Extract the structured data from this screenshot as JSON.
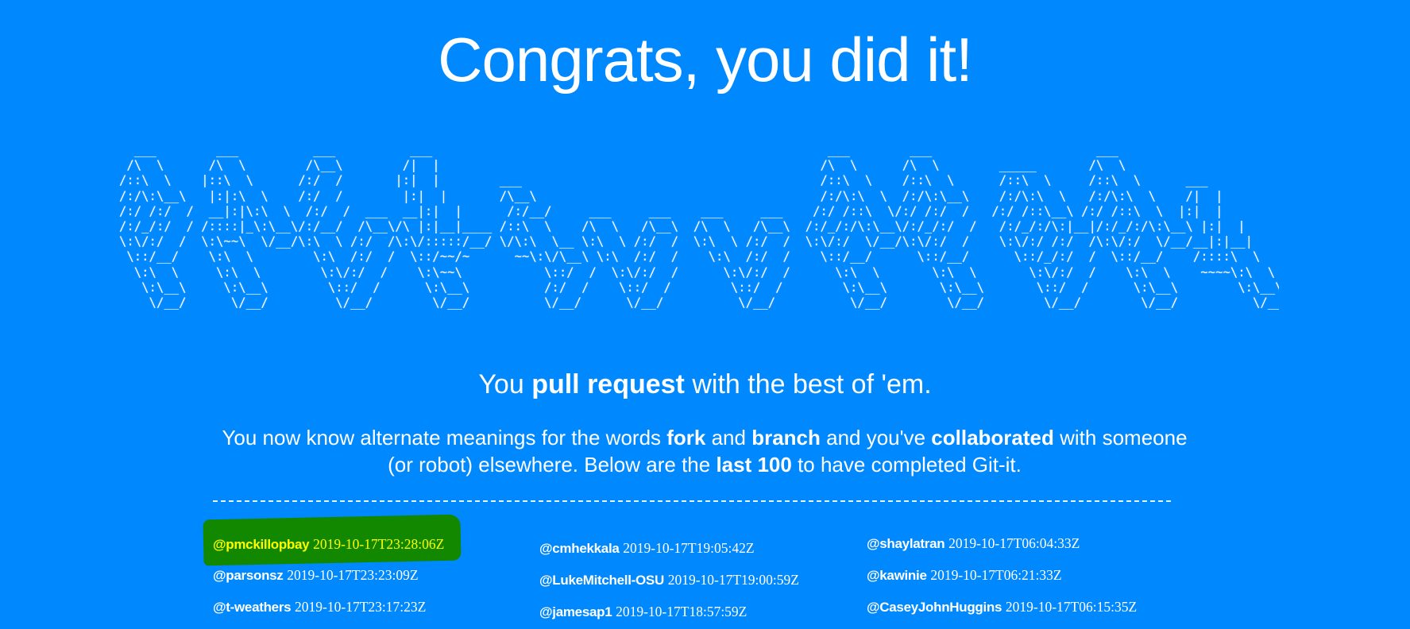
{
  "title": "Congrats, you did it!",
  "ascii_art": "  ___        ___          ___          ___                                                     ___        ___                      ___\n /\\  \\      /\\  \\        /\\__\\        /|  |                                                   /\\  \\      /\\  \\        _____       /\\  \\\n/::\\  \\    |::\\  \\      /:/  /       |:|  |        ___                                        /::\\  \\    /::\\  \\      /::\\  \\     /::\\  \\      ___\n/:/\\:\\__\\   |:|:\\  \\    /:/  /        |:|  |       /\\__\\                                      /:/\\:\\  \\  /:/\\:\\__\\    /:/\\:\\  \\   /:/\\:\\  \\    /|  |\n/:/ /:/  /  __|:|\\:\\  \\  /:/  /  ___  __|:|  |      /:/__/     ___     ___    ___     ___    /:/ /::\\  \\/:/ /:/  /   /:/ /::\\__\\ /:/ /::\\  \\  |:|  |\n/:/_/:/  / /::::|_\\:\\__\\/:/__/  /\\__\\/\\ |:|__|____ /::\\  \\    /\\  \\   /\\__\\  /\\  \\   /\\__\\  /:/_/:/\\:\\__\\/:/_/:/  /   /:/_/:/\\:|__|/:/_/:/\\:\\__\\ |:|  |\n\\:\\/:/  /  \\:\\~~\\  \\/__/\\:\\  \\ /:/  /\\:\\/:::::/__/ \\/\\:\\  \\__ \\:\\  \\ /:/  /  \\:\\  \\ /:/  /  \\:\\/:/  \\/__/\\:\\/:/  /    \\:\\/:/ /:/  /\\:\\/:/  \\/__/__|:|__|\n \\::/__/    \\:\\  \\        \\:\\  /:/  /  \\::/~~/~      ~~\\:\\/\\__\\ \\:\\  /:/  /    \\:\\  /:/  /    \\::/__/      \\::/__/      \\::/_/:/  /  \\::/__/    /::::\\  \\\n  \\:\\  \\     \\:\\  \\        \\:\\/:/  /    \\:\\~~\\           \\::/  /  \\:\\/:/  /      \\:\\/:/  /      \\:\\  \\       \\:\\  \\       \\:\\/:/  /    \\:\\  \\    ~~~~\\:\\  \\\n   \\:\\__\\     \\:\\__\\        \\::/  /      \\:\\__\\          /:/  /    \\::/  /        \\::/  /        \\:\\__\\       \\:\\__\\       \\::/  /      \\:\\__\\        \\:\\__\\\n    \\/__/      \\/__/         \\/__/        \\/__/          \\/__/      \\/__/          \\/__/          \\/__/        \\/__/        \\/__/        \\/__/          \\/__/",
  "tagline": {
    "pre": "You ",
    "bold": "pull request",
    "post": " with the best of 'em."
  },
  "description": {
    "part1": "You now know alternate meanings for the words ",
    "bold1": "fork",
    "part2": " and ",
    "bold2": "branch",
    "part3": " and you've ",
    "bold3": "collaborated",
    "part4": " with someone (or robot) elsewhere. Below are the ",
    "bold4": "last 100",
    "part5": " to have completed Git-it."
  },
  "columns": [
    [
      {
        "handle": "@pmckillopbay",
        "time": "2019-10-17T23:28:06Z",
        "highlight": true
      },
      {
        "handle": "@parsonsz",
        "time": "2019-10-17T23:23:09Z"
      },
      {
        "handle": "@t-weathers",
        "time": "2019-10-17T23:17:23Z"
      }
    ],
    [
      {
        "handle": "@cmhekkala",
        "time": "2019-10-17T19:05:42Z"
      },
      {
        "handle": "@LukeMitchell-OSU",
        "time": "2019-10-17T19:00:59Z"
      },
      {
        "handle": "@jamesap1",
        "time": "2019-10-17T18:57:59Z"
      }
    ],
    [
      {
        "handle": "@shaylatran",
        "time": "2019-10-17T06:04:33Z"
      },
      {
        "handle": "@kawinie",
        "time": "2019-10-17T06:21:33Z"
      },
      {
        "handle": "@CaseyJohnHuggins",
        "time": "2019-10-17T06:15:35Z"
      }
    ]
  ],
  "colors": {
    "background": "#0088ff",
    "text": "#ffffff",
    "highlight_marker": "#118800",
    "highlight_text": "#ffff00"
  }
}
